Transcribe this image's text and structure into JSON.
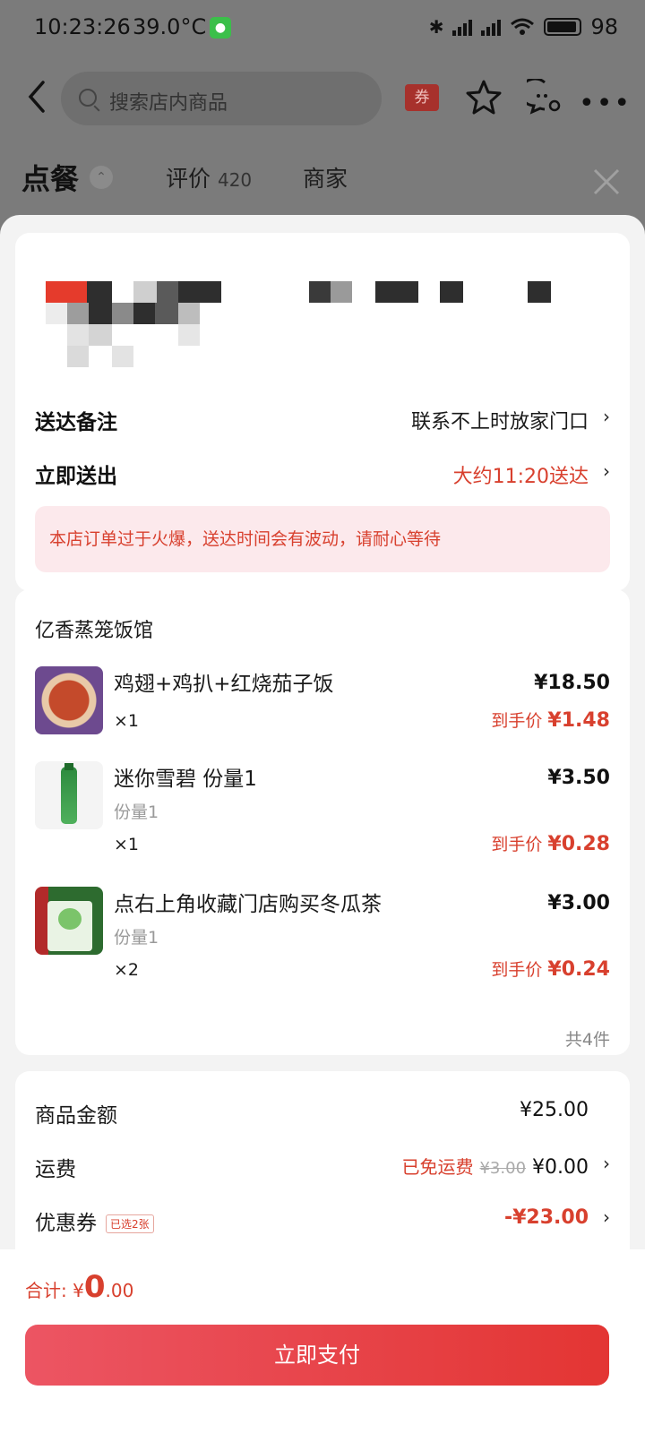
{
  "status_bar": {
    "time": "10:23:26",
    "temperature": "39.0°C",
    "battery": "98"
  },
  "topbar": {
    "search_placeholder": "搜索店内商品",
    "coupon_label": "券"
  },
  "tabs": {
    "order": "点餐",
    "review": "评价",
    "review_count": "420",
    "merchant": "商家"
  },
  "delivery": {
    "note_label": "送达备注",
    "note_value": "联系不上时放家门口",
    "time_label": "立即送出",
    "time_value": "大约11:20送达",
    "notice": "本店订单过于火爆，送达时间会有波动，请耐心等待"
  },
  "order": {
    "shop_name": "亿香蒸笼饭馆",
    "items": [
      {
        "name": "鸡翅+鸡扒+红烧茄子饭",
        "spec": "",
        "qty": "×1",
        "price": "¥18.50",
        "final_label": "到手价",
        "final_price": "¥1.48"
      },
      {
        "name": "迷你雪碧 份量1",
        "spec": "份量1",
        "qty": "×1",
        "price": "¥3.50",
        "final_label": "到手价",
        "final_price": "¥0.28"
      },
      {
        "name": "点右上角收藏门店购买冬瓜茶",
        "spec": "份量1",
        "qty": "×2",
        "price": "¥3.00",
        "final_label": "到手价",
        "final_price": "¥0.24"
      }
    ],
    "count_text": "共4件"
  },
  "fees": {
    "goods_label": "商品金额",
    "goods_value": "¥25.00",
    "shipping_label": "运费",
    "shipping_free_tag": "已免运费",
    "shipping_original": "¥3.00",
    "shipping_value": "¥0.00",
    "coupon_label": "优惠券",
    "coupon_badge": "已选2张",
    "coupon_value": "-¥23.00"
  },
  "bottom": {
    "total_label": "合计:",
    "currency": "¥",
    "total_int": "0",
    "total_dec": ".00",
    "pay_button": "立即支付"
  },
  "colors": {
    "accent_red": "#d8402e",
    "pay_gradient_start": "#ec5563",
    "pay_gradient_end": "#e33533",
    "notice_bg": "#fce9ec"
  }
}
